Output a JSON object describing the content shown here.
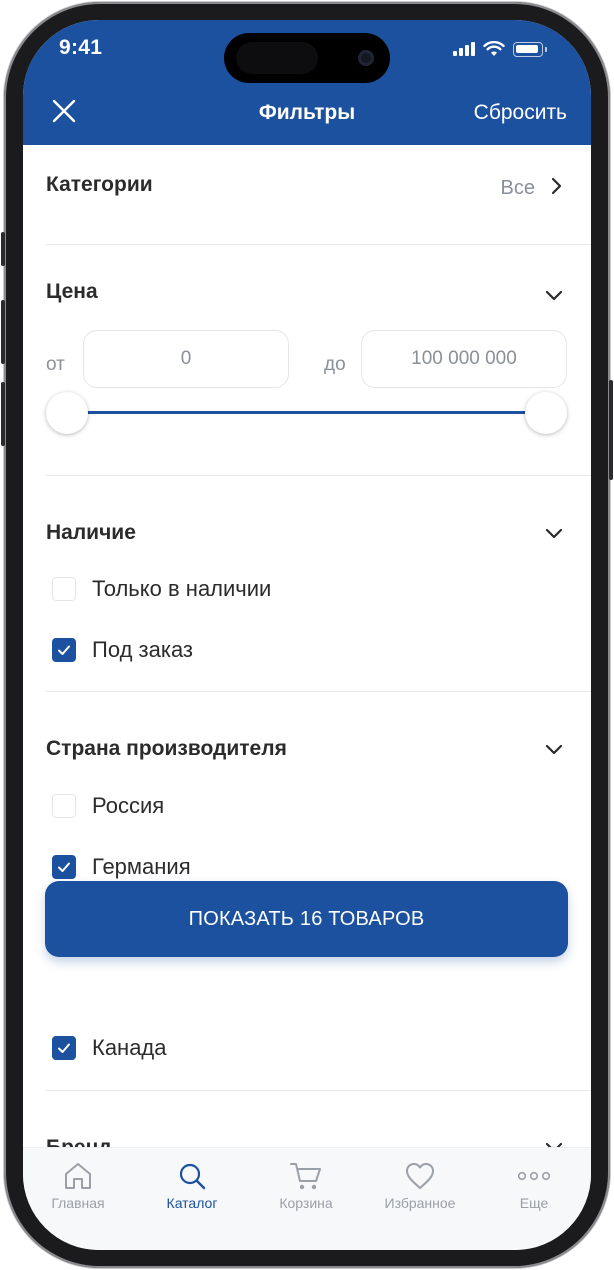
{
  "status_bar": {
    "time": "9:41"
  },
  "header": {
    "title": "Фильтры",
    "reset_label": "Сбросить",
    "background": "#1b519f"
  },
  "categories": {
    "title": "Категории",
    "value": "Все"
  },
  "price": {
    "title": "Цена",
    "from_label": "от",
    "from_value": "0",
    "to_label": "до",
    "to_value": "100 000 000"
  },
  "availability": {
    "title": "Наличие",
    "options": [
      {
        "label": "Только в наличии",
        "checked": false
      },
      {
        "label": "Под заказ",
        "checked": true
      }
    ]
  },
  "country": {
    "title": "Страна производителя",
    "options": [
      {
        "label": "Россия",
        "checked": false
      },
      {
        "label": "Германия",
        "checked": true
      },
      {
        "label": "Канада",
        "checked": true
      }
    ]
  },
  "show_button": {
    "label": "ПОКАЗАТЬ 16 ТОВАРОВ"
  },
  "brand": {
    "title": "Бренд"
  },
  "tabbar": {
    "tabs": [
      {
        "label": "Главная",
        "icon": "home-icon",
        "active": false
      },
      {
        "label": "Каталог",
        "icon": "search-icon",
        "active": true
      },
      {
        "label": "Корзина",
        "icon": "cart-icon",
        "active": false
      },
      {
        "label": "Избранное",
        "icon": "heart-icon",
        "active": false
      },
      {
        "label": "Еще",
        "icon": "more-icon",
        "active": false
      }
    ]
  },
  "colors": {
    "accent": "#1b519f",
    "muted": "#9aa0a8",
    "text": "#2b2b2b"
  }
}
